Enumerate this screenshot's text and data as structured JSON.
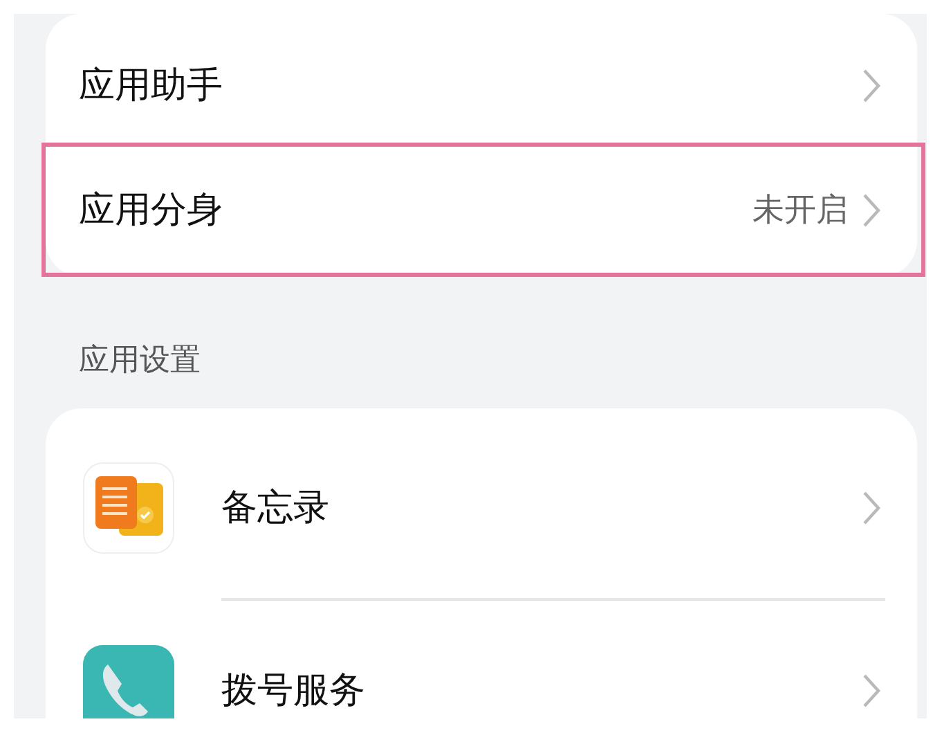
{
  "top_group": [
    {
      "label": "应用助手",
      "highlighted": false
    },
    {
      "label": "应用分身",
      "value": "未开启",
      "highlighted": true
    }
  ],
  "section": {
    "title": "应用设置",
    "items": [
      {
        "label": "备忘录",
        "kind": "notes"
      },
      {
        "label": "拨号服务",
        "kind": "phone"
      }
    ]
  }
}
